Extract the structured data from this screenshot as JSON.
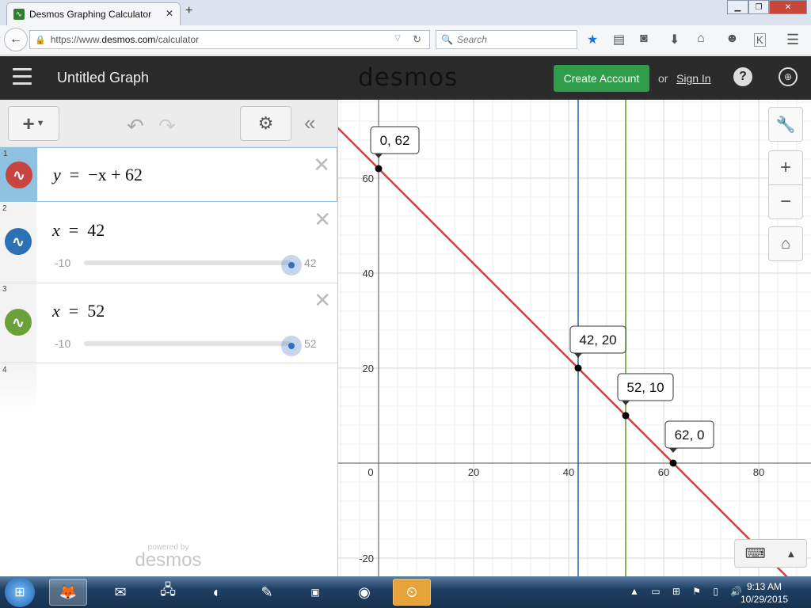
{
  "browser": {
    "tab_title": "Desmos Graphing Calculator",
    "url_prefix": "https://www.",
    "url_domain": "desmos.com",
    "url_path": "/calculator",
    "search_placeholder": "Search"
  },
  "header": {
    "graph_title": "Untitled Graph",
    "logo": "desmos",
    "create_account": "Create Account",
    "or": "or",
    "sign_in": "Sign In",
    "help": "?"
  },
  "expressions": [
    {
      "num": "1",
      "color": "#c74440",
      "lhs": "y",
      "eq": "=",
      "rhs": "−x + 62"
    },
    {
      "num": "2",
      "color": "#2d70b3",
      "lhs": "x",
      "eq": "=",
      "rhs": "42",
      "slider": {
        "min": "-10",
        "max": "42",
        "fraction": 1.0
      }
    },
    {
      "num": "3",
      "color": "#6ca03a",
      "lhs": "x",
      "eq": "=",
      "rhs": "52",
      "slider": {
        "min": "-10",
        "max": "52",
        "fraction": 1.0
      }
    },
    {
      "num": "4"
    }
  ],
  "powered_by": {
    "line1": "powered by",
    "line2": "desmos"
  },
  "graph": {
    "x_ticks": [
      "0",
      "20",
      "40",
      "60",
      "80"
    ],
    "y_ticks": [
      "60",
      "40",
      "20",
      "-20"
    ],
    "line_color": "#c74440",
    "vline1_color": "#2d70b3",
    "vline2_color": "#6ca03a",
    "vline1_x": 42,
    "vline2_x": 52,
    "points": [
      {
        "x": 0,
        "y": 62,
        "label": "0, 62"
      },
      {
        "x": 42,
        "y": 20,
        "label": "42, 20"
      },
      {
        "x": 52,
        "y": 10,
        "label": "52, 10"
      },
      {
        "x": 62,
        "y": 0,
        "label": "62, 0"
      }
    ]
  },
  "taskbar": {
    "time": "9:13 AM",
    "date": "10/29/2015"
  }
}
